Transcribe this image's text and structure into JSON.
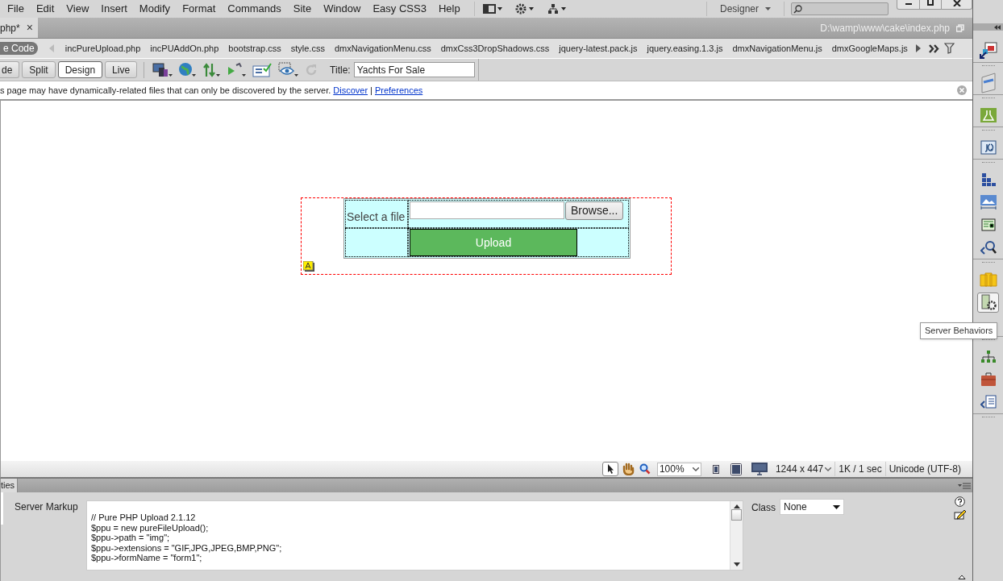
{
  "menu": [
    "File",
    "Edit",
    "View",
    "Insert",
    "Modify",
    "Format",
    "Commands",
    "Site",
    "Window",
    "Easy CSS3",
    "Help"
  ],
  "workspace": "Designer",
  "document_tab": {
    "label": "php*",
    "close": "×"
  },
  "file_path": "D:\\wamp\\www\\cake\\index.php",
  "source_code_pill": "e Code",
  "related_files": [
    "incPureUpload.php",
    "incPUAddOn.php",
    "bootstrap.css",
    "style.css",
    "dmxNavigationMenu.css",
    "dmxCss3DropShadows.css",
    "jquery-latest.pack.js",
    "jquery.easing.1.3.js",
    "dmxNavigationMenu.js",
    "dmxGoogleMaps.js"
  ],
  "views": [
    {
      "label": "de",
      "selected": false
    },
    {
      "label": "Split",
      "selected": false
    },
    {
      "label": "Design",
      "selected": true
    },
    {
      "label": "Live",
      "selected": false
    }
  ],
  "title_label": "Title:",
  "title_value": "Yachts For Sale",
  "info_bar": {
    "message": "s page may have dynamically-related files that can only be discovered by the server.",
    "links": [
      "Discover",
      "Preferences"
    ],
    "separator": "|"
  },
  "form": {
    "label": "Select a file",
    "browse_button": "Browse...",
    "submit_button": "Upload"
  },
  "status_bar": {
    "zoom": "100%",
    "size": "1244 x 447",
    "download": "1K / 1 sec",
    "encoding": "Unicode (UTF-8)"
  },
  "properties": {
    "tab": "ties",
    "section": "Server Markup",
    "code_lines": [
      "// Pure PHP Upload 2.1.12",
      "$ppu = new pureFileUpload();",
      "$ppu->path = \"img\";",
      "$ppu->extensions = \"GIF,JPG,JPEG,BMP,PNG\";",
      "$ppu->formName = \"form1\";"
    ],
    "class_label": "Class",
    "class_value": "None"
  },
  "tooltip": "Server Behaviors"
}
